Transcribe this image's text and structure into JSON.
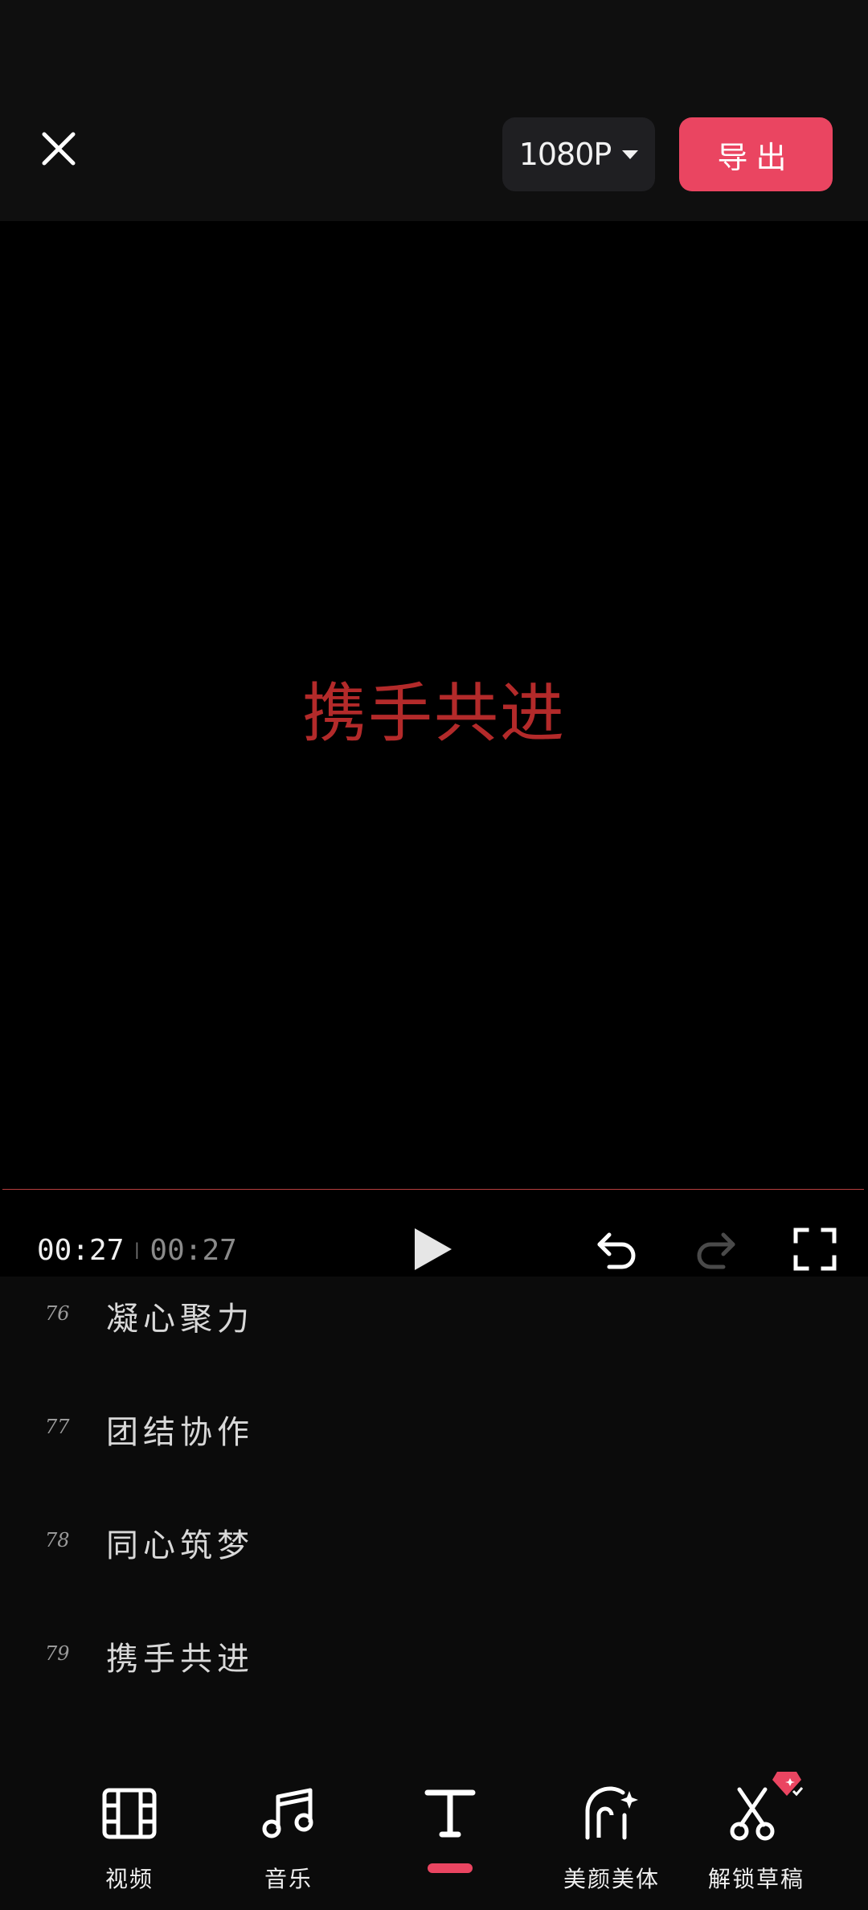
{
  "header": {
    "resolution_label": "1080P",
    "export_label": "导出"
  },
  "preview": {
    "caption": "携手共进",
    "caption_color": "#b32a2a"
  },
  "player": {
    "current_time": "00:27",
    "total_time": "00:27"
  },
  "subtitles": [
    {
      "num": "76",
      "text": "凝心聚力"
    },
    {
      "num": "77",
      "text": "团结协作"
    },
    {
      "num": "78",
      "text": "同心筑梦"
    },
    {
      "num": "79",
      "text": "携手共进"
    }
  ],
  "toolbar": {
    "items": [
      {
        "label": "视频",
        "icon": "film-icon"
      },
      {
        "label": "音乐",
        "icon": "music-note-icon"
      },
      {
        "label": "",
        "icon": "text-icon",
        "active": true
      },
      {
        "label": "美颜美体",
        "icon": "beauty-face-icon"
      },
      {
        "label": "解锁草稿",
        "icon": "scissors-icon"
      }
    ]
  },
  "colors": {
    "accent": "#ea4561",
    "background": "#0b0b0b"
  }
}
